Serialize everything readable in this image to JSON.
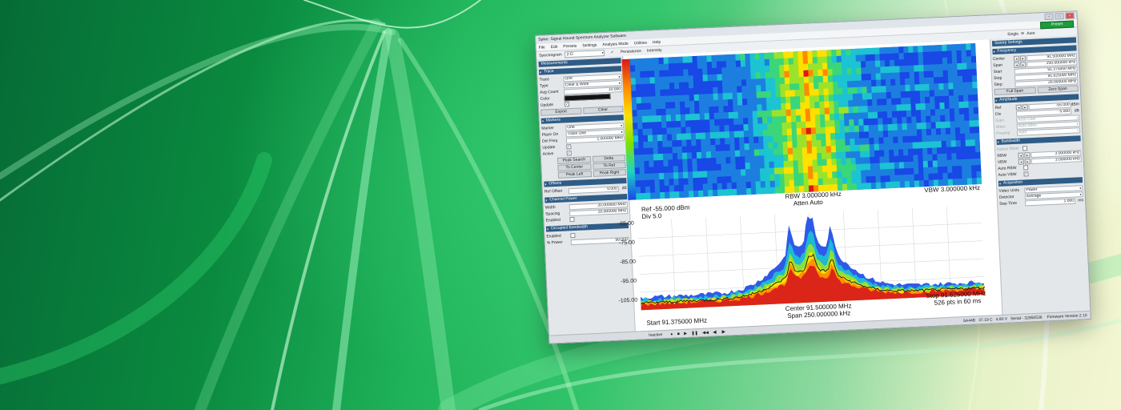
{
  "window": {
    "title": "Spike: Signal Hound Spectrum Analyzer Software",
    "menu": [
      "File",
      "Edit",
      "Presets",
      "Settings",
      "Analysis Mode",
      "Utilities",
      "Help"
    ],
    "controls": {
      "single": "Single",
      "auto": "Auto",
      "preset": "Preset"
    }
  },
  "toolbar": {
    "mode_label": "Spectrogram",
    "mode_value": "2-D",
    "persistence": "Persistence",
    "intensity": "Intensity"
  },
  "left_panel": {
    "title": "Measurements",
    "trace": {
      "head": "Trace",
      "trace_label": "Trace",
      "trace_value": "One",
      "type_label": "Type",
      "type_value": "Clear & Write",
      "avg_label": "Avg Count",
      "avg_value": "10.000",
      "color_label": "Color",
      "update_label": "Update",
      "export": "Export",
      "clear": "Clear"
    },
    "markers": {
      "head": "Markers",
      "marker_label": "Marker",
      "marker_value": "One",
      "place_label": "Place On",
      "place_value": "Trace One",
      "delfreq_label": "Del Freq",
      "delfreq_value": "1.000000 MHz",
      "update_label": "Update",
      "active_label": "Active",
      "peak_search": "Peak Search",
      "delta": "Delta",
      "to_center": "To Center",
      "to_ref": "To Ref",
      "peak_left": "Peak Left",
      "peak_right": "Peak Right"
    },
    "offsets": {
      "head": "Offsets",
      "ref_label": "Ref Offset",
      "ref_value": "0.000",
      "ref_unit": "dB"
    },
    "channel_power": {
      "head": "Channel Power",
      "width_label": "Width",
      "width_value": "20.000000 MHz",
      "spacing_label": "Spacing",
      "spacing_value": "20.000000 MHz",
      "enabled_label": "Enabled"
    },
    "occupied_bw": {
      "head": "Occupied Bandwidth",
      "enabled_label": "Enabled",
      "power_label": "% Power",
      "power_value": "99.000"
    }
  },
  "right_panel": {
    "title": "Sweep Settings",
    "frequency": {
      "head": "Frequency",
      "center_label": "Center",
      "center_value": "91.500000 MHz",
      "span_label": "Span",
      "span_value": "250.000000 kHz",
      "start_label": "Start",
      "start_value": "91.375000 MHz",
      "stop_label": "Stop",
      "stop_value": "91.625000 MHz",
      "step_label": "Step",
      "step_value": "20.000000 MHz",
      "full_span": "Full Span",
      "zero_span": "Zero Span"
    },
    "amplitude": {
      "head": "Amplitude",
      "ref_label": "Ref",
      "ref_value": "-55.000",
      "ref_unit": "dBm",
      "div_label": "Div",
      "div_value": "5.000",
      "div_unit": "dB",
      "gain_label": "Gain",
      "gain_value": "Auto Gain",
      "atten_label": "Atten",
      "atten_value": "Auto Atten",
      "preamp_label": "Preamp",
      "preamp_value": "Auto"
    },
    "bandwidth": {
      "head": "Bandwidth",
      "native_label": "Native RBW",
      "rbw_label": "RBW",
      "rbw_value": "3.000000 kHz",
      "vbw_label": "VBW",
      "vbw_value": "3.000000 kHz",
      "autorbw_label": "Auto RBW",
      "autovbw_label": "Auto VBW"
    },
    "acquisition": {
      "head": "Acquisition",
      "units_label": "Video Units",
      "units_value": "Power",
      "detector_label": "Detector",
      "detector_value": "Average",
      "swp_label": "Swp Time",
      "swp_value": "1.000",
      "swp_unit": "ms"
    }
  },
  "plot": {
    "ref": "Ref -55.000 dBm",
    "div": "Div 5.0",
    "rbw": "RBW 3.000000 kHz",
    "atten": "Atten Auto",
    "vbw": "VBW 3.000000 kHz",
    "start": "Start 91.375000 MHz",
    "center": "Center 91.500000 MHz",
    "span": "Span 250.000000 kHz",
    "stop": "Stop 91.625000 MHz",
    "pts": "526 pts in 60 ms",
    "y_ticks": [
      "-65.00",
      "-75.00",
      "-85.00",
      "-95.00",
      "-105.00"
    ]
  },
  "status": {
    "state": "Inactive",
    "device": "SA44B",
    "temp": "37.19 C",
    "voltage": "4.80 V",
    "serial": "Serial - 32950536",
    "firmware": "Firmware Version 2.10"
  },
  "colors": {
    "accent": "#2e5c86",
    "preset": "#1e9b3c",
    "trace": "#111111"
  }
}
